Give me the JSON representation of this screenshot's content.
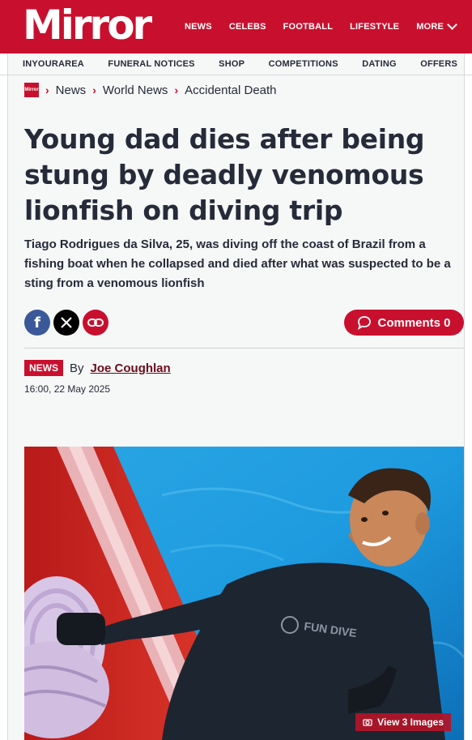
{
  "header": {
    "logo": "Mirror",
    "nav": [
      "NEWS",
      "CELEBS",
      "FOOTBALL",
      "LIFESTYLE"
    ],
    "more_label": "MORE",
    "color_brand": "#c8102e"
  },
  "subnav": [
    "INYOURAREA",
    "FUNERAL NOTICES",
    "SHOP",
    "COMPETITIONS",
    "DATING",
    "OFFERS"
  ],
  "breadcrumb": {
    "logo": "Mirror",
    "items": [
      "News",
      "World News",
      "Accidental Death"
    ]
  },
  "article": {
    "headline": "Young dad dies after being stung by deadly venomous lionfish on diving trip",
    "standfirst": "Tiago Rodrigues da Silva, 25, was diving off the coast of Brazil from a fishing boat when he collapsed and died after what was suspected to be a sting from a venomous lionfish",
    "comments_label": "Comments 0",
    "tag": "NEWS",
    "by_label": "By",
    "author": "Joe Coughlan",
    "date": "16:00, 22 May 2025",
    "view_images_label": "View 3 Images",
    "wetsuit_text": "FUN DIVE"
  },
  "icons": {
    "share_facebook": "facebook-icon",
    "share_x": "x-icon",
    "share_link": "link-icon",
    "comment": "speech-bubble-icon",
    "camera": "camera-icon"
  }
}
